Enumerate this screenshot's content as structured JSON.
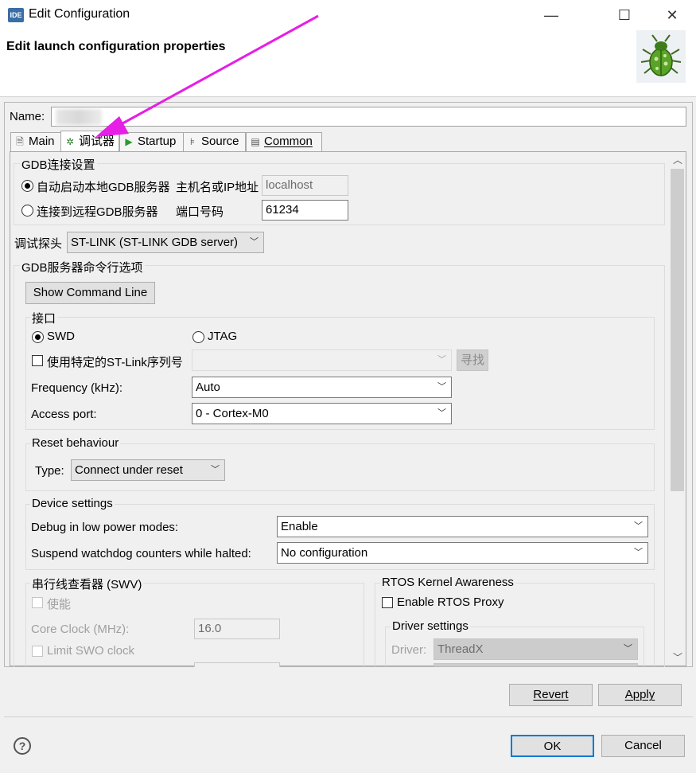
{
  "window": {
    "title": "Edit Configuration",
    "app_icon_text": "IDE",
    "minimize": "—",
    "maximize": "☐",
    "close": "✕"
  },
  "header": {
    "title": "Edit launch configuration properties",
    "icon": "bug-icon"
  },
  "name": {
    "label": "Name:",
    "value": ""
  },
  "tabs": [
    {
      "label": "Main",
      "icon": "document-icon"
    },
    {
      "label": "调试器",
      "icon": "debug-bug-icon",
      "active": true
    },
    {
      "label": "Startup",
      "icon": "play-icon"
    },
    {
      "label": "Source",
      "icon": "source-icon"
    },
    {
      "label": "Common",
      "icon": "window-icon"
    }
  ],
  "gdb_connection": {
    "title": "GDB连接设置",
    "auto_start_label": "自动启动本地GDB服务器",
    "remote_label": "连接到远程GDB服务器",
    "host_label": "主机名或IP地址",
    "host_value": "localhost",
    "port_label": "端口号码",
    "port_value": "61234",
    "selected": "auto"
  },
  "probe": {
    "label": "调试探头",
    "value": "ST-LINK (ST-LINK GDB server)"
  },
  "gdb_server_options": {
    "title": "GDB服务器命令行选项",
    "show_cmd_button": "Show Command Line"
  },
  "interface": {
    "title": "接口",
    "swd_label": "SWD",
    "jtag_label": "JTAG",
    "selected": "SWD",
    "serial_check_label": "使用特定的ST-Link序列号",
    "find_button": "寻找",
    "frequency_label": "Frequency (kHz):",
    "frequency_value": "Auto",
    "access_port_label": "Access port:",
    "access_port_value": "0 - Cortex-M0"
  },
  "reset": {
    "title": "Reset behaviour",
    "type_label": "Type:",
    "type_value": "Connect under reset"
  },
  "device": {
    "title": "Device settings",
    "low_power_label": "Debug in low power modes:",
    "low_power_value": "Enable",
    "watchdog_label": "Suspend watchdog counters while halted:",
    "watchdog_value": "No configuration"
  },
  "swv": {
    "title": "串行线查看器 (SWV)",
    "enable_label": "使能",
    "core_clock_label": "Core Clock (MHz):",
    "core_clock_value": "16.0",
    "limit_swo_label": "Limit SWO clock"
  },
  "rtos": {
    "title": "RTOS Kernel Awareness",
    "enable_proxy_label": "Enable RTOS Proxy",
    "driver_settings_title": "Driver settings",
    "driver_label": "Driver:",
    "driver_value": "ThreadX"
  },
  "footer": {
    "revert": "Revert",
    "apply": "Apply",
    "ok": "OK",
    "cancel": "Cancel",
    "help": "?"
  },
  "colors": {
    "accent": "#0078d7",
    "annotation_arrow": "#e61ee6",
    "panel_bg": "#f0f0f0"
  }
}
